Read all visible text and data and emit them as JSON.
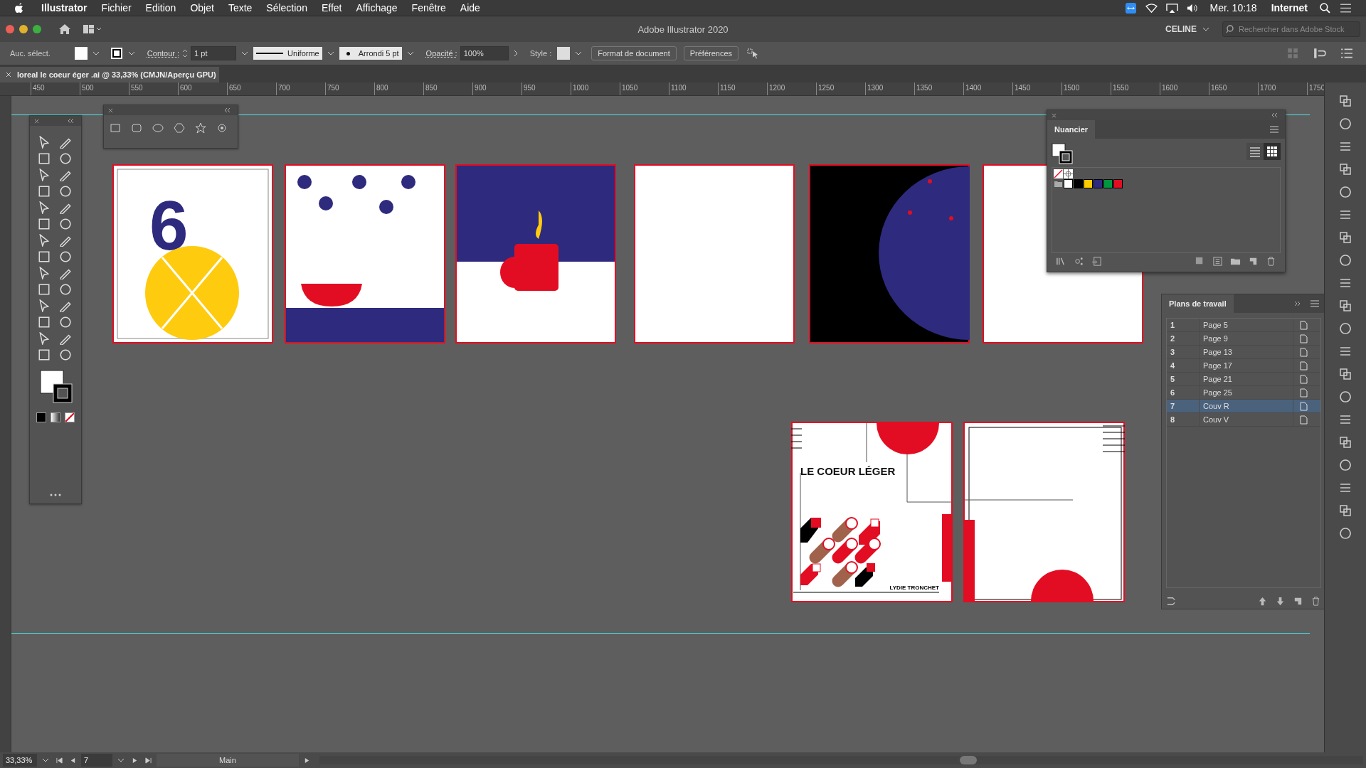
{
  "menu_bar": {
    "app": "Illustrator",
    "items": [
      "Fichier",
      "Edition",
      "Objet",
      "Texte",
      "Sélection",
      "Effet",
      "Affichage",
      "Fenêtre",
      "Aide"
    ],
    "clock": "Mer. 10:18",
    "network": "Internet"
  },
  "title_bar": {
    "title": "Adobe Illustrator 2020",
    "workspace": "CELINE",
    "search": {
      "placeholder": "Rechercher dans Adobe Stock"
    }
  },
  "control_bar": {
    "selection": "Auc. sélect.",
    "stroke_label": "Contour :",
    "stroke_weight": "1 pt",
    "profile": "Uniforme",
    "brush": "Arrondi 5 pt",
    "opacity_label": "Opacité :",
    "opacity": "100%",
    "style_label": "Style :",
    "buttons": [
      "Format de document",
      "Préférences"
    ]
  },
  "document_tab": {
    "title": "loreal le coeur éger .ai @ 33,33% (CMJN/Aperçu GPU)"
  },
  "ruler": {
    "labels": [
      "450",
      "500",
      "550",
      "600",
      "650",
      "700",
      "750",
      "800",
      "850",
      "900",
      "950",
      "1000",
      "1050",
      "1100",
      "1150",
      "1200",
      "1250",
      "1300",
      "1350",
      "1400",
      "1450",
      "1500",
      "1550",
      "1600",
      "1650",
      "1700",
      "1750"
    ]
  },
  "canvas": {
    "page_number": "6",
    "cover_title": "LE COEUR LÉGER",
    "cover_author": "LYDIE TRONCHET"
  },
  "swatches_panel": {
    "title": "Nuancier",
    "swatches": [
      {
        "color": "#ffffff"
      },
      {
        "color": "#000000"
      },
      {
        "color": "#ffcc00"
      },
      {
        "color": "#2e2a7e"
      },
      {
        "color": "#009640"
      },
      {
        "color": "#e30d23"
      }
    ]
  },
  "artboards_panel": {
    "title": "Plans de travail",
    "rows": [
      {
        "number": "1",
        "name": "Page 5",
        "selected": false
      },
      {
        "number": "2",
        "name": "Page 9",
        "selected": false
      },
      {
        "number": "3",
        "name": "Page 13",
        "selected": false
      },
      {
        "number": "4",
        "name": "Page 17",
        "selected": false
      },
      {
        "number": "5",
        "name": "Page 21",
        "selected": false
      },
      {
        "number": "6",
        "name": "Page 25",
        "selected": false
      },
      {
        "number": "7",
        "name": "Couv R",
        "selected": true
      },
      {
        "number": "8",
        "name": "Couv V",
        "selected": false
      }
    ]
  },
  "status_bar": {
    "zoom": "33,33%",
    "artboard": "7",
    "tool": "Main"
  }
}
